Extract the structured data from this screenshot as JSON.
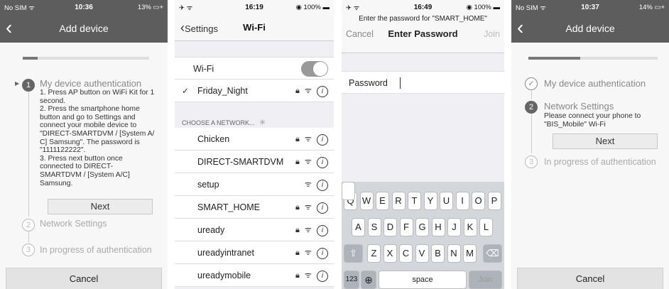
{
  "panel1": {
    "status": {
      "carrier": "No SIM ᯤ",
      "time": "10:36",
      "battery": "13% ▭+"
    },
    "back_icon": "‹",
    "title": "Add device",
    "progress": 0.12,
    "step1_number": "1",
    "step1_title": "My device authentication",
    "step1_lines": [
      "1. Press AP button on WiFi Kit for 1",
      "second.",
      "2. Press the smartphone home",
      "button and go to Settings and",
      "connect your mobile device to",
      "\"DIRECT-SMARTDVM / [System A/",
      "C] Samsung\". The password is",
      "\"1111122222\".",
      "3. Press next button once",
      "connected to DIRECT-",
      "SMARTDVM / [System A/C]",
      "Samsung."
    ],
    "next": "Next",
    "step2_number": "2",
    "step2_title": "Network Settings",
    "step3_number": "3",
    "step3_title": "In progress of authentication",
    "cancel": "Cancel"
  },
  "panel2": {
    "status": {
      "left": "✈ ᯤ",
      "time": "16:19",
      "battery": "◉ 100% ▬"
    },
    "back": "Settings",
    "title": "Wi-Fi",
    "wifi_label": "Wi-Fi",
    "wifi_on": true,
    "connected": "Friday_Night",
    "section": "CHOOSE A NETWORK...",
    "networks": [
      {
        "name": "Chicken",
        "locked": true
      },
      {
        "name": "DIRECT-SMARTDVM",
        "locked": true
      },
      {
        "name": "setup",
        "locked": false
      },
      {
        "name": "SMART_HOME",
        "locked": true
      },
      {
        "name": "uready",
        "locked": true
      },
      {
        "name": "ureadyintranet",
        "locked": true
      },
      {
        "name": "ureadymobile",
        "locked": true
      }
    ]
  },
  "panel3": {
    "status": {
      "left": "✈ ᯤ",
      "time": "16:49",
      "battery": "◉ 100% ▬"
    },
    "prompt": "Enter the password for \"SMART_HOME\"",
    "cancel": "Cancel",
    "title": "Enter Password",
    "join": "Join",
    "password_label": "Password",
    "row1": [
      "Q",
      "W",
      "E",
      "R",
      "T",
      "Y",
      "U",
      "I",
      "O",
      "P"
    ],
    "row2": [
      "A",
      "S",
      "D",
      "F",
      "G",
      "H",
      "J",
      "K",
      "L"
    ],
    "row3": [
      "Z",
      "X",
      "C",
      "V",
      "B",
      "N",
      "M"
    ],
    "shift": "⇧",
    "delete": "⌫",
    "k123": "123",
    "globe": "⊕",
    "space": "space",
    "join_key": "Join"
  },
  "panel4": {
    "status": {
      "carrier": "No SIM ᯤ",
      "time": "10:37",
      "battery": "14% ▭+"
    },
    "back_icon": "‹",
    "title": "Add device",
    "progress": 0.4,
    "step1_title": "My device authentication",
    "step2_number": "2",
    "step2_title": "Network Settings",
    "step2_desc1": "Please connect your phone to",
    "step2_desc2": "\"BIS_Mobile\" Wi-Fi",
    "next": "Next",
    "step3_number": "3",
    "step3_title": "In progress of authentication",
    "cancel": "Cancel"
  }
}
